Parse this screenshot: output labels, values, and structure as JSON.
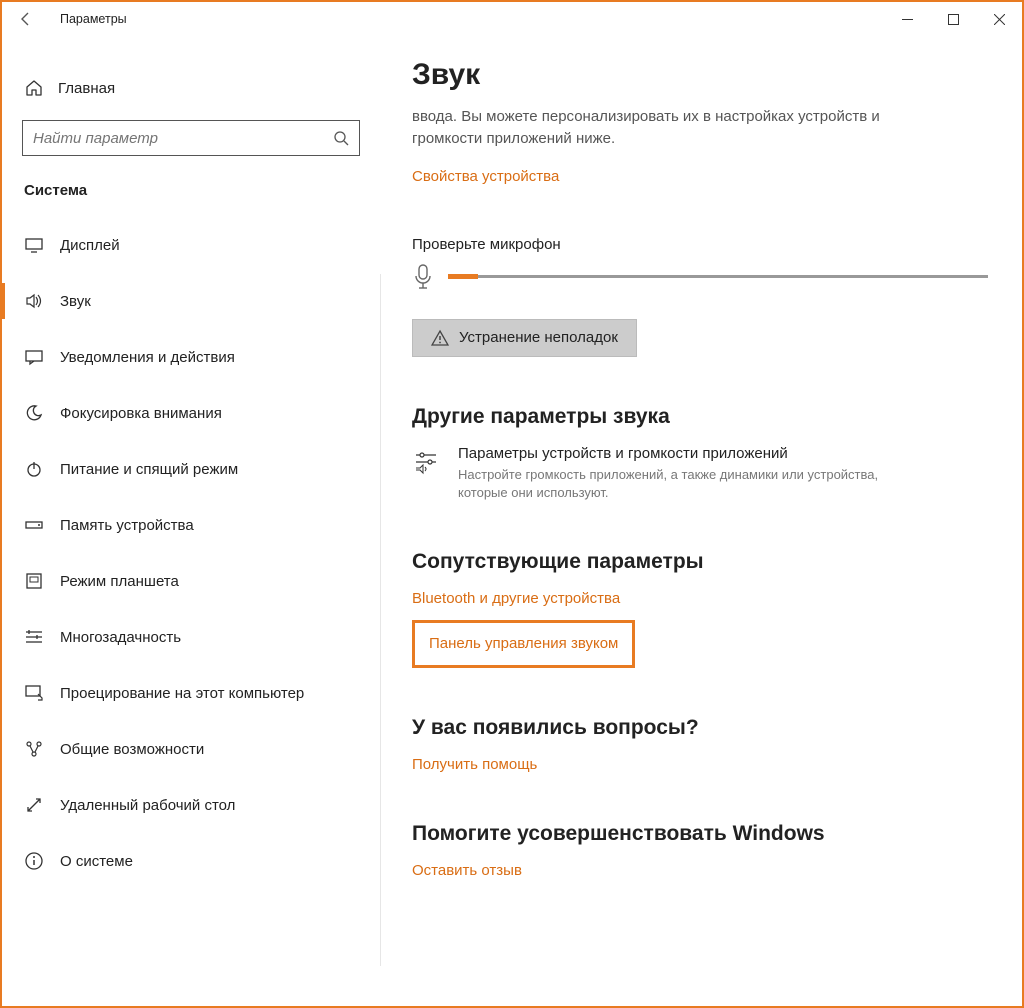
{
  "titlebar": {
    "title": "Параметры"
  },
  "sidebar": {
    "home": "Главная",
    "search_placeholder": "Найти параметр",
    "section": "Система",
    "items": [
      {
        "label": "Дисплей"
      },
      {
        "label": "Звук"
      },
      {
        "label": "Уведомления и действия"
      },
      {
        "label": "Фокусировка внимания"
      },
      {
        "label": "Питание и спящий режим"
      },
      {
        "label": "Память устройства"
      },
      {
        "label": "Режим планшета"
      },
      {
        "label": "Многозадачность"
      },
      {
        "label": "Проецирование на этот компьютер"
      },
      {
        "label": "Общие возможности"
      },
      {
        "label": "Удаленный рабочий стол"
      },
      {
        "label": "О системе"
      }
    ]
  },
  "main": {
    "title": "Звук",
    "desc": "ввода. Вы можете персонализировать их в настройках устройств и громкости приложений ниже.",
    "device_props": "Свойства устройства",
    "mic_check": "Проверьте микрофон",
    "troubleshoot": "Устранение неполадок",
    "other_heading": "Другие параметры звука",
    "app_volume_title": "Параметры устройств и громкости приложений",
    "app_volume_desc": "Настройте громкость приложений, а также динамики или устройства, которые они используют.",
    "related_heading": "Сопутствующие параметры",
    "bluetooth_link": "Bluetooth и другие устройства",
    "sound_panel_link": "Панель управления звуком",
    "help_heading": "У вас появились вопросы?",
    "help_link": "Получить помощь",
    "feedback_heading": "Помогите усовершенствовать Windows",
    "feedback_link": "Оставить отзыв"
  }
}
